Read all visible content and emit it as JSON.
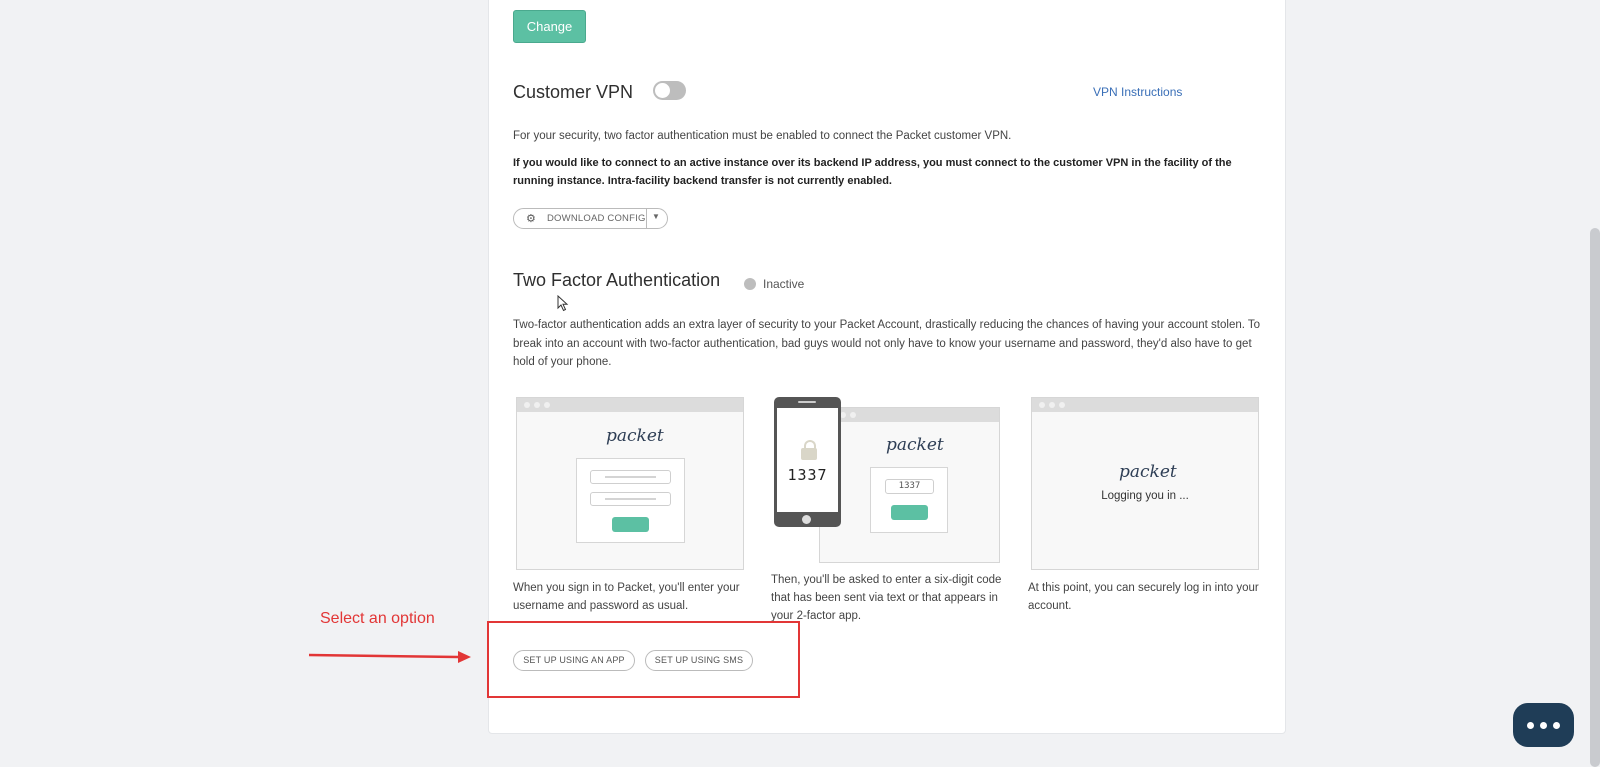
{
  "vpn_section": {
    "change_label": "Change",
    "title": "Customer VPN",
    "toggle_state": "off",
    "instructions_link": "VPN Instructions",
    "desc1": "For your security, two factor authentication must be enabled to connect the Packet customer VPN.",
    "desc2": "If you would like to connect to an active instance over its backend IP address, you must connect to the customer VPN in the facility of the running instance. Intra-facility backend transfer is not currently enabled.",
    "download_label": "DOWNLOAD CONFIG",
    "download_icon": "gears-icon",
    "dropdown_icon": "caret-down-icon"
  },
  "tfa_section": {
    "title": "Two Factor Authentication",
    "status": "Inactive",
    "description": "Two-factor authentication adds an extra layer of security to your Packet Account, drastically reducing the chances of having your account stolen. To break into an account with two-factor authentication, bad guys would not only have to know your username and password, they'd also have to get hold of your phone.",
    "steps": [
      {
        "logo": "packet",
        "caption": "When you sign in to Packet, you'll enter your username and password as usual."
      },
      {
        "logo": "packet",
        "phone_code": "1337",
        "field_code": "1337",
        "caption": "Then, you'll be asked to enter a six-digit code that has been sent via text or that appears in your 2-factor app."
      },
      {
        "logo": "packet",
        "message": "Logging you in ...",
        "caption": "At this point, you can securely log in into your account."
      }
    ],
    "buttons": {
      "app": "SET UP USING AN APP",
      "sms": "SET UP USING SMS"
    }
  },
  "annotation": {
    "label": "Select an option",
    "color": "#e23636"
  },
  "colors": {
    "accent": "#5cc0a3",
    "link": "#3a6fb7",
    "chat": "#1f3d57"
  },
  "chat_icon": "more-dots-icon"
}
